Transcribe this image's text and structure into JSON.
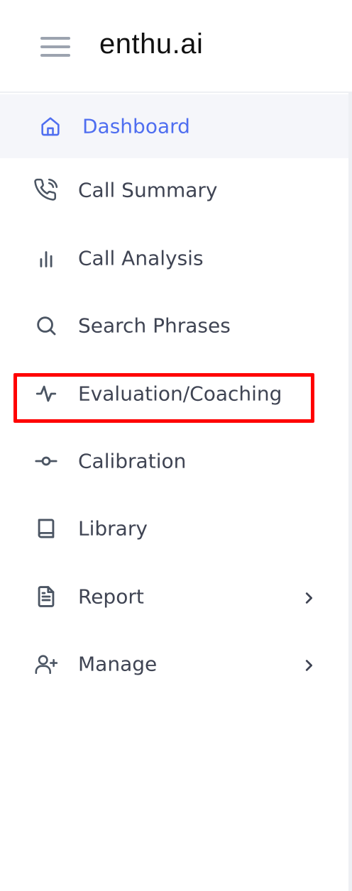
{
  "header": {
    "logo_text": "enthu.ai",
    "menu_icon": "hamburger-menu-icon"
  },
  "nav": {
    "items": [
      {
        "label": "Dashboard",
        "icon": "home-icon",
        "active": true
      },
      {
        "label": "Call Summary",
        "icon": "phone-call-icon"
      },
      {
        "label": "Call Analysis",
        "icon": "bar-chart-icon"
      },
      {
        "label": "Search Phrases",
        "icon": "search-icon"
      },
      {
        "label": "Evaluation/Coaching",
        "icon": "activity-icon",
        "highlighted": true
      },
      {
        "label": "Calibration",
        "icon": "git-commit-icon"
      },
      {
        "label": "Library",
        "icon": "book-icon"
      },
      {
        "label": "Report",
        "icon": "file-text-icon",
        "has_submenu": true
      },
      {
        "label": "Manage",
        "icon": "user-plus-icon",
        "has_submenu": true
      }
    ]
  },
  "colors": {
    "accent": "#4f6ef0",
    "text": "#3f4453",
    "active_bg": "#f5f6fa",
    "highlight": "#ff0000"
  }
}
